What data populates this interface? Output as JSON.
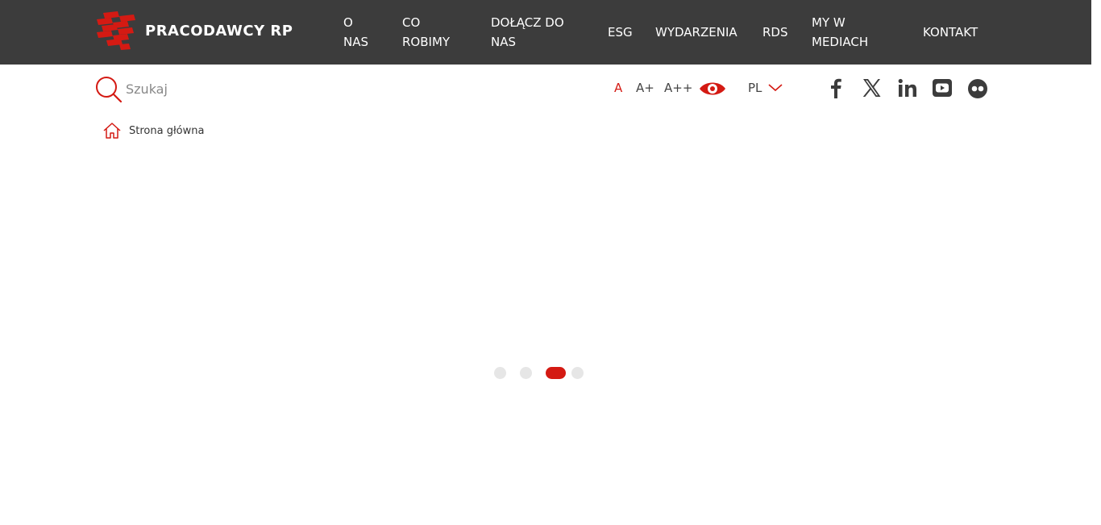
{
  "brand": {
    "name": "PRACODAWCY RP",
    "accent": "#d41a13",
    "nav_bg": "#3c3c3c"
  },
  "nav": {
    "items": [
      {
        "label": "O NAS"
      },
      {
        "label": "CO ROBIMY"
      },
      {
        "label": "DOŁĄCZ DO NAS"
      },
      {
        "label": "ESG"
      },
      {
        "label": "WYDARZENIA"
      },
      {
        "label": "RDS"
      },
      {
        "label": "MY W MEDIACH"
      },
      {
        "label": "KONTAKT"
      }
    ]
  },
  "search": {
    "placeholder": "Szukaj",
    "icon": "search-icon"
  },
  "accessibility": {
    "font_sizes": [
      "A",
      "A+",
      "A++"
    ],
    "active_font_size": "A",
    "contrast_icon": "eye-icon"
  },
  "language": {
    "selected": "PL",
    "icon": "chevron-down-icon"
  },
  "social": [
    "facebook-icon",
    "x-icon",
    "linkedin-icon",
    "youtube-icon",
    "flickr-icon"
  ],
  "breadcrumb": {
    "home_label": "Strona główna",
    "icon": "home-icon"
  },
  "slider": {
    "count": 4,
    "active_index": 2
  }
}
